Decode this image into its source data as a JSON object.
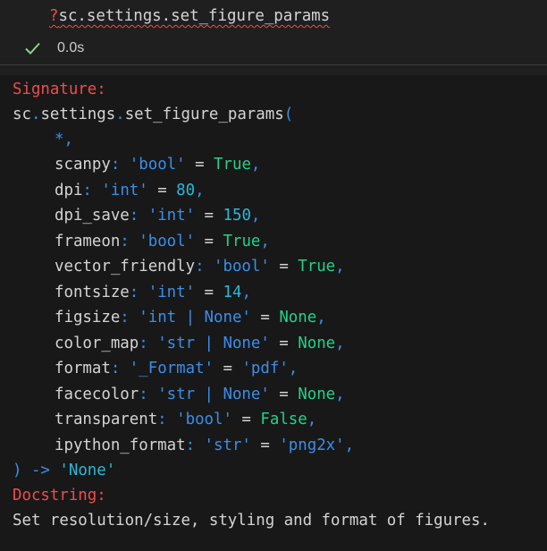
{
  "input": {
    "prefix": "?",
    "code": "sc.settings.set_figure_params",
    "exec_time": "0.0s",
    "status_icon": "check-icon"
  },
  "output": {
    "signature_label": "Signature:",
    "func_obj": "sc",
    "func_mid": "settings",
    "func_name": "set_figure_params",
    "open_paren": "(",
    "star": "*,",
    "params": [
      {
        "name": "scanpy",
        "type": "'bool'",
        "default": "True"
      },
      {
        "name": "dpi",
        "type": "'int'",
        "default": "80"
      },
      {
        "name": "dpi_save",
        "type": "'int'",
        "default": "150"
      },
      {
        "name": "frameon",
        "type": "'bool'",
        "default": "True"
      },
      {
        "name": "vector_friendly",
        "type": "'bool'",
        "default": "True"
      },
      {
        "name": "fontsize",
        "type": "'int'",
        "default": "14"
      },
      {
        "name": "figsize",
        "type": "'int | None'",
        "default": "None"
      },
      {
        "name": "color_map",
        "type": "'str | None'",
        "default": "None"
      },
      {
        "name": "format",
        "type": "'_Format'",
        "default": "'pdf'"
      },
      {
        "name": "facecolor",
        "type": "'str | None'",
        "default": "None"
      },
      {
        "name": "transparent",
        "type": "'bool'",
        "default": "False"
      },
      {
        "name": "ipython_format",
        "type": "'str'",
        "default": "'png2x'"
      }
    ],
    "close": ")",
    "arrow": " -> ",
    "return_type": "'None'",
    "docstring_label": "Docstring:",
    "docstring_text": "Set resolution/size, styling and format of figures."
  }
}
